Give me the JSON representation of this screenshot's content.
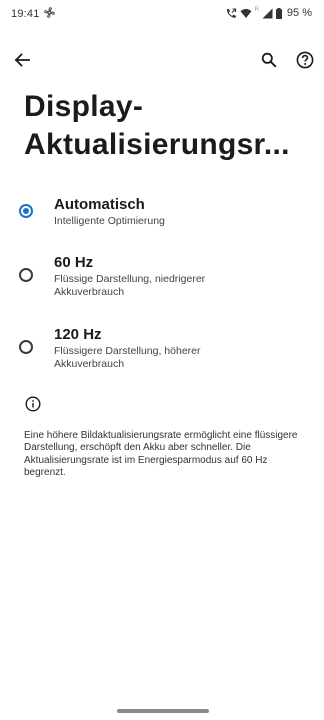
{
  "status_bar": {
    "time": "19:41",
    "signal_label": "R",
    "battery_percent": "95 %"
  },
  "app_bar": {
    "back_icon": "arrow-back-icon",
    "search_icon": "search-icon",
    "help_icon": "help-icon"
  },
  "page": {
    "title_line1": "Display-",
    "title_line2": "Aktualisierungsr..."
  },
  "options": [
    {
      "label": "Automatisch",
      "summary": "Intelligente Optimierung",
      "selected": true
    },
    {
      "label": "60 Hz",
      "summary": "Flüssige Darstellung, niedrigerer Akkuverbrauch",
      "selected": false
    },
    {
      "label": "120 Hz",
      "summary": "Flüssigere Darstellung, höherer Akkuverbrauch",
      "selected": false
    }
  ],
  "footer": {
    "info_icon": "info-icon",
    "text": "Eine höhere Bildaktualisierungsrate ermöglicht eine flüssigere Darstellung, erschöpft den Akku aber schneller. Die Aktualisierungsrate ist im Energiesparmodus auf 60 Hz begrenzt."
  },
  "colors": {
    "accent": "#1a73c8",
    "text_primary": "#1b1b1f",
    "background": "#ffffff"
  }
}
